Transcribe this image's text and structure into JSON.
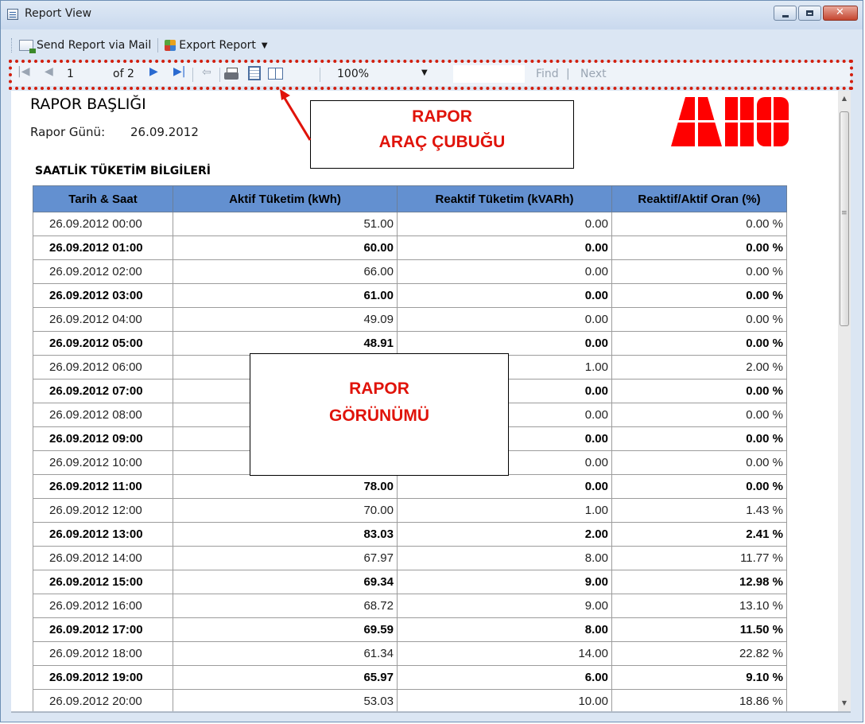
{
  "window": {
    "title": "Report View",
    "icon": "report-icon"
  },
  "menubar": {
    "send": "Send Report via Mail",
    "export": "Export Report",
    "icons": [
      "mail-icon",
      "export-icon",
      "chevron-down-icon"
    ]
  },
  "toolbar": {
    "page": "1",
    "of_pages": "of 2",
    "zoom": "100%",
    "find": "Find",
    "separator": "|",
    "next": "Next",
    "icons": [
      "first-page-icon",
      "prev-page-icon",
      "next-page-icon",
      "last-page-icon",
      "back-icon",
      "print-icon",
      "print-layout-icon",
      "page-setup-icon"
    ]
  },
  "report": {
    "title": "RAPOR BAŞLIĞI",
    "date_label": "Rapor Günü:",
    "date_value": "26.09.2012",
    "logo": "ABB",
    "section": "SAATLİK TÜKETİM BİLGİLERİ",
    "table": {
      "headers": [
        "Tarih & Saat",
        "Aktif Tüketim (kWh)",
        "Reaktif Tüketim (kVARh)",
        "Reaktif/Aktif Oran (%)"
      ],
      "rows": [
        [
          "26.09.2012 00:00",
          "51.00",
          "0.00",
          "0.00 %"
        ],
        [
          "26.09.2012 01:00",
          "60.00",
          "0.00",
          "0.00 %"
        ],
        [
          "26.09.2012 02:00",
          "66.00",
          "0.00",
          "0.00 %"
        ],
        [
          "26.09.2012 03:00",
          "61.00",
          "0.00",
          "0.00 %"
        ],
        [
          "26.09.2012 04:00",
          "49.09",
          "0.00",
          "0.00 %"
        ],
        [
          "26.09.2012 05:00",
          "48.91",
          "0.00",
          "0.00 %"
        ],
        [
          "26.09.2012 06:00",
          "",
          "1.00",
          "2.00 %"
        ],
        [
          "26.09.2012 07:00",
          "",
          "0.00",
          "0.00 %"
        ],
        [
          "26.09.2012 08:00",
          "",
          "0.00",
          "0.00 %"
        ],
        [
          "26.09.2012 09:00",
          "",
          "0.00",
          "0.00 %"
        ],
        [
          "26.09.2012 10:00",
          "",
          "0.00",
          "0.00 %"
        ],
        [
          "26.09.2012 11:00",
          "78.00",
          "0.00",
          "0.00 %"
        ],
        [
          "26.09.2012 12:00",
          "70.00",
          "1.00",
          "1.43 %"
        ],
        [
          "26.09.2012 13:00",
          "83.03",
          "2.00",
          "2.41 %"
        ],
        [
          "26.09.2012 14:00",
          "67.97",
          "8.00",
          "11.77 %"
        ],
        [
          "26.09.2012 15:00",
          "69.34",
          "9.00",
          "12.98 %"
        ],
        [
          "26.09.2012 16:00",
          "68.72",
          "9.00",
          "13.10 %"
        ],
        [
          "26.09.2012 17:00",
          "69.59",
          "8.00",
          "11.50 %"
        ],
        [
          "26.09.2012 18:00",
          "61.34",
          "14.00",
          "22.82 %"
        ],
        [
          "26.09.2012 19:00",
          "65.97",
          "6.00",
          "9.10 %"
        ],
        [
          "26.09.2012 20:00",
          "53.03",
          "10.00",
          "18.86 %"
        ]
      ]
    }
  },
  "annotations": {
    "toolbar_line1": "RAPOR",
    "toolbar_line2": "ARAÇ ÇUBUĞU",
    "view_line1": "RAPOR",
    "view_line2": "GÖRÜNÜMÜ",
    "color": "#e0130a"
  },
  "colors": {
    "header_bg": "#6390d0",
    "annotation_red": "#d21f0e",
    "logo_red": "#ff0000"
  }
}
